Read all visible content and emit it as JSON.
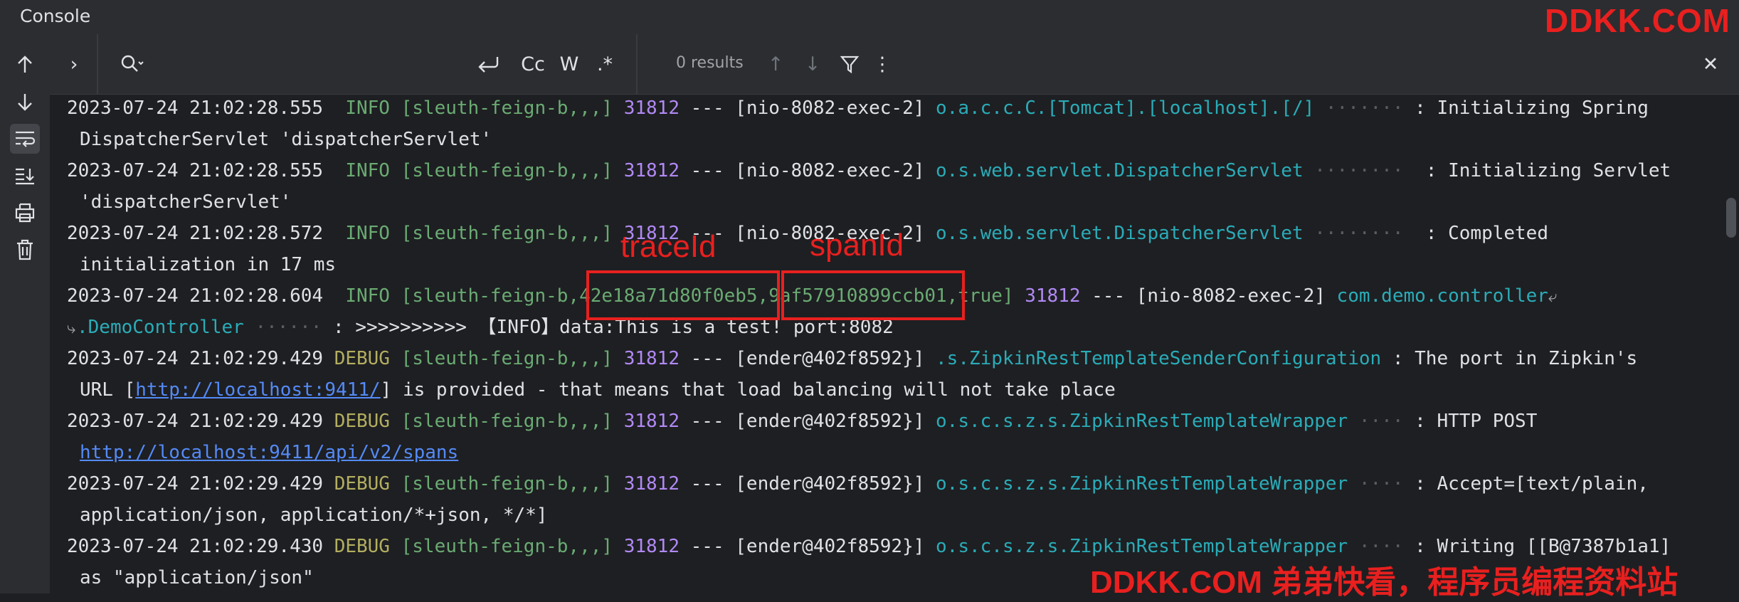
{
  "window": {
    "title": "Console"
  },
  "brand": {
    "top": "DDKK.COM",
    "bottom": "DDKK.COM 弟弟快看，程序员编程资料站"
  },
  "toolbar": {
    "expand": "›",
    "search": "Q·",
    "wrap": "⮐",
    "match_case": "Cc",
    "whole_word": "W",
    "regex": ".*",
    "results": "0 results",
    "prev": "↑",
    "next": "↓",
    "filter": "▼",
    "more": "⋮",
    "close": "✕"
  },
  "annotations": {
    "trace_label": "traceId",
    "span_label": "spanId"
  },
  "log": [
    {
      "ts": "2023-07-24 21:02:28.555",
      "level": " INFO",
      "svc": "[sleuth-feign-b,,,]",
      "pid": "31812",
      "sep": "---",
      "thread": "[nio-8082-exec-2]",
      "logger": "o.a.c.c.C.[Tomcat].[localhost].[/]",
      "dots": "·······",
      "msg": ": Initializing Spring",
      "cont": "DispatcherServlet 'dispatcherServlet'"
    },
    {
      "ts": "2023-07-24 21:02:28.555",
      "level": " INFO",
      "svc": "[sleuth-feign-b,,,]",
      "pid": "31812",
      "sep": "---",
      "thread": "[nio-8082-exec-2]",
      "logger": "o.s.web.servlet.DispatcherServlet",
      "dots": "········",
      "msg": ": Initializing Servlet",
      "cont": "'dispatcherServlet'"
    },
    {
      "ts": "2023-07-24 21:02:28.572",
      "level": " INFO",
      "svc": "[sleuth-feign-b,,,]",
      "pid": "31812",
      "sep": "---",
      "thread": "[nio-8082-exec-2]",
      "logger": "o.s.web.servlet.DispatcherServlet",
      "dots": "········",
      "msg": ": Completed",
      "cont": "initialization in 17 ms"
    },
    {
      "ts": "2023-07-24 21:02:28.604",
      "level": " INFO",
      "svc_a": "[sleuth-feign-b,",
      "trace": "42e18a71d80f0eb5",
      "comma": ",",
      "span": "9af57910899ccb01",
      "svc_b": ",true]",
      "pid": "31812",
      "sep": "---",
      "thread": "[nio-8082-exec-2]",
      "logger": "com.demo.controller",
      "logger_cont": ".DemoController",
      "dots": "······",
      "msg": ": >>>>>>>>>> 【INFO】data:This is a test! port:8082"
    },
    {
      "ts": "2023-07-24 21:02:29.429",
      "level": "DEBUG",
      "svc": "[sleuth-feign-b,,,]",
      "pid": "31812",
      "sep": "---",
      "thread": "[ender@402f8592}]",
      "logger": ".s.ZipkinRestTemplateSenderConfiguration",
      "dots": "",
      "msg": ": The port in Zipkin's",
      "cont_a": "URL [",
      "link": "http://localhost:9411/",
      "cont_b": "] is provided - that means that load balancing will not take place"
    },
    {
      "ts": "2023-07-24 21:02:29.429",
      "level": "DEBUG",
      "svc": "[sleuth-feign-b,,,]",
      "pid": "31812",
      "sep": "---",
      "thread": "[ender@402f8592}]",
      "logger": "o.s.c.s.z.s.ZipkinRestTemplateWrapper",
      "dots": "····",
      "msg": ": HTTP POST",
      "link": "http://localhost:9411/api/v2/spans"
    },
    {
      "ts": "2023-07-24 21:02:29.429",
      "level": "DEBUG",
      "svc": "[sleuth-feign-b,,,]",
      "pid": "31812",
      "sep": "---",
      "thread": "[ender@402f8592}]",
      "logger": "o.s.c.s.z.s.ZipkinRestTemplateWrapper",
      "dots": "····",
      "msg": ": Accept=[text/plain,",
      "cont": "application/json, application/*+json, */*]"
    },
    {
      "ts": "2023-07-24 21:02:29.430",
      "level": "DEBUG",
      "svc": "[sleuth-feign-b,,,]",
      "pid": "31812",
      "sep": "---",
      "thread": "[ender@402f8592}]",
      "logger": "o.s.c.s.z.s.ZipkinRestTemplateWrapper",
      "dots": "····",
      "msg": ": Writing [[B@7387b1a1]",
      "cont": "as \"application/json\""
    }
  ]
}
